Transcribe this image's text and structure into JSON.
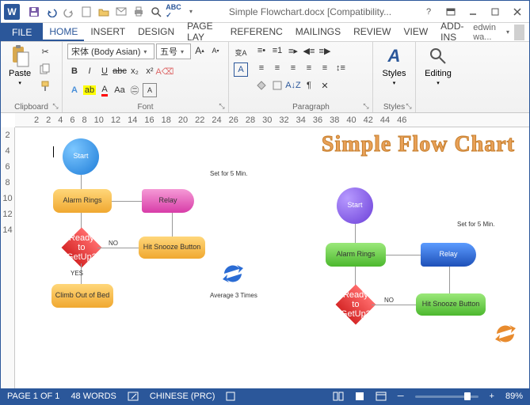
{
  "titlebar": {
    "title": "Simple Flowchart.docx [Compatibility..."
  },
  "tabs": {
    "file": "FILE",
    "items": [
      "HOME",
      "INSERT",
      "DESIGN",
      "PAGE LAY",
      "REFERENC",
      "MAILINGS",
      "REVIEW",
      "VIEW",
      "ADD-INS"
    ],
    "active": 0,
    "user": "edwin wa..."
  },
  "ribbon": {
    "clipboard": {
      "label": "Clipboard",
      "paste": "Paste"
    },
    "font": {
      "label": "Font",
      "family": "宋体 (Body Asian)",
      "size": "五号"
    },
    "paragraph": {
      "label": "Paragraph"
    },
    "styles": {
      "label": "Styles",
      "btn": "Styles"
    },
    "editing": {
      "label": "Editing",
      "btn": "Editing"
    }
  },
  "ruler": {
    "marks": [
      "2",
      "2",
      "4",
      "6",
      "8",
      "10",
      "12",
      "14",
      "16",
      "18",
      "20",
      "22",
      "24",
      "26",
      "28",
      "30",
      "32",
      "34",
      "36",
      "38",
      "40",
      "42",
      "44",
      "46"
    ]
  },
  "vruler": {
    "marks": [
      "2",
      "4",
      "6",
      "8",
      "10",
      "12",
      "14"
    ]
  },
  "doc": {
    "title": "Simple Flow Chart",
    "left": {
      "start": "Start",
      "alarm": "Alarm Rings",
      "relay": "Relay",
      "set": "Set for 5 Min.",
      "ready": "Ready to GetUp?",
      "no": "NO",
      "yes": "YES",
      "hit": "Hit Snooze Button",
      "climb": "Climb Out of Bed",
      "avg": "Average 3 Times"
    },
    "right": {
      "start": "Start",
      "alarm": "Alarm Rings",
      "relay": "Relay",
      "set": "Set for 5 Min.",
      "ready": "Ready to GetUp?",
      "no": "NO",
      "hit": "Hit Snooze Button"
    }
  },
  "status": {
    "page": "PAGE 1 OF 1",
    "words": "48 WORDS",
    "lang": "CHINESE (PRC)",
    "zoom": "89%"
  }
}
